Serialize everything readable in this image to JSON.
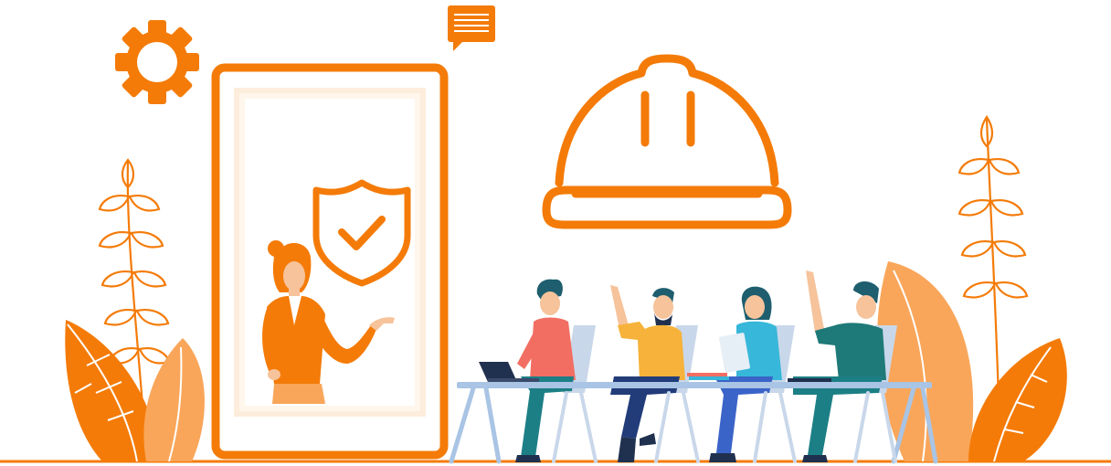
{
  "illustration": {
    "theme": "workplace-safety-training",
    "colors": {
      "accent": "#F47B08",
      "accent_light": "#F9A65A",
      "accent_pale": "#FBD3AE",
      "skin": "#F6C39B",
      "table": "#A9C4E4",
      "chair": "#C9D7EA",
      "navy": "#20304F",
      "teal_hair": "#1E5E6E",
      "shirt_coral": "#F26E63",
      "shirt_yellow": "#F6B23A",
      "shirt_cyan": "#37B7D9",
      "shirt_green": "#1E7A78",
      "pants_teal": "#1C7F86",
      "pants_blue": "#3A64C8",
      "pants_navy": "#223C7A"
    },
    "icons": [
      "gear-icon",
      "chat-bubble-icon",
      "phone-frame",
      "shield-check-icon",
      "hard-hat-icon",
      "plant-icon",
      "leaf-icon"
    ],
    "people": [
      "presenter",
      "attendee-laptop",
      "attendee-hand-raised-beard",
      "attendee-reading",
      "attendee-hand-raised"
    ]
  }
}
